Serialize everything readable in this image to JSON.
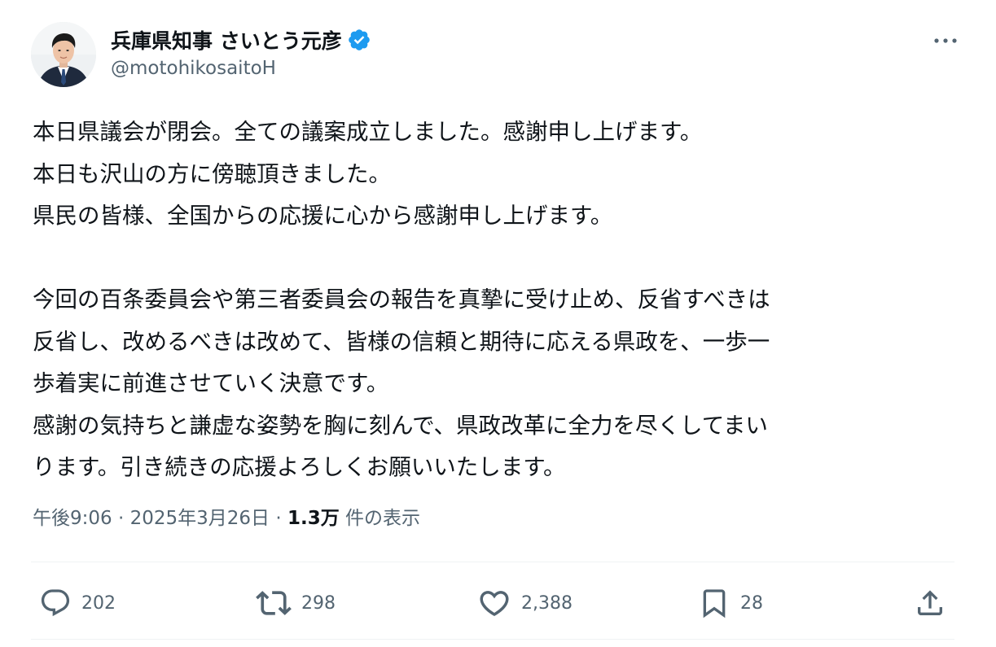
{
  "author": {
    "display_name": "兵庫県知事 さいとう元彦",
    "handle": "@motohikosaitoH",
    "verified": true,
    "avatar_icon": "profile-photo-man-in-suit"
  },
  "post": {
    "lines": [
      "本日県議会が閉会。全ての議案成立しました。感謝申し上げます。",
      "本日も沢山の方に傍聴頂きました。",
      "県民の皆様、全国からの応援に心から感謝申し上げます。",
      "",
      "今回の百条委員会や第三者委員会の報告を真摯に受け止め、反省すべきは",
      "反省し、改めるべきは改めて、皆様の信頼と期待に応える県政を、一歩一",
      "歩着実に前進させていく決意です。",
      "感謝の気持ちと謙虚な姿勢を胸に刻んで、県政改革に全力を尽くしてまい",
      "ります。引き続きの応援よろしくお願いいたします。"
    ]
  },
  "meta": {
    "time": "午後9:06",
    "separator": " · ",
    "date": "2025年3月26日",
    "views_count": "1.3万",
    "views_label": " 件の表示"
  },
  "actions": {
    "reply_count": "202",
    "retweet_count": "298",
    "like_count": "2,388",
    "bookmark_count": "28"
  },
  "colors": {
    "text_primary": "#0f1419",
    "text_secondary": "#536471",
    "verified_badge": "#1d9bf0",
    "divider": "#eff3f4"
  }
}
